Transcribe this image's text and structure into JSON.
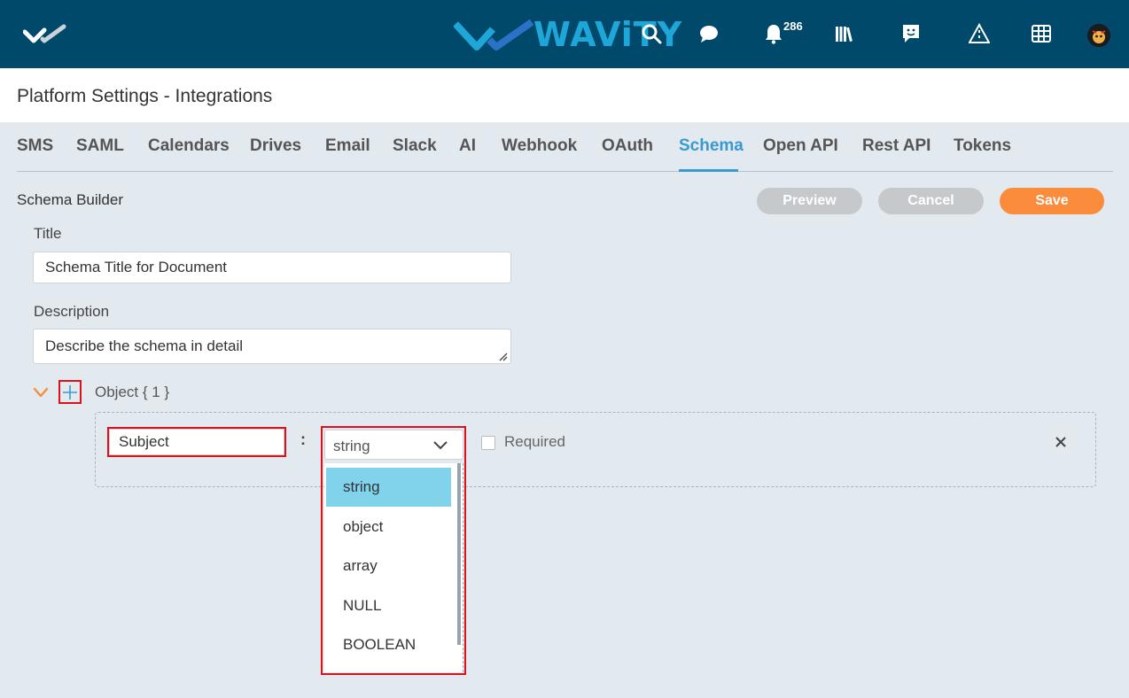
{
  "header": {
    "brand_name": "WAViTY",
    "notification_count": "286",
    "icons": [
      "double-check-logo-icon",
      "search-icon",
      "chat-icon",
      "bell-icon",
      "library-icon",
      "feedback-icon",
      "road-icon",
      "grid-icon",
      "avatar"
    ]
  },
  "page": {
    "title": "Platform Settings - Integrations"
  },
  "tabs": [
    {
      "label": "SMS"
    },
    {
      "label": "SAML"
    },
    {
      "label": "Calendars"
    },
    {
      "label": "Drives"
    },
    {
      "label": "Email"
    },
    {
      "label": "Slack"
    },
    {
      "label": "AI"
    },
    {
      "label": "Webhook"
    },
    {
      "label": "OAuth"
    },
    {
      "label": "Schema",
      "active": true
    },
    {
      "label": "Open API"
    },
    {
      "label": "Rest API"
    },
    {
      "label": "Tokens"
    }
  ],
  "schema_builder": {
    "heading": "Schema Builder",
    "preview_label": "Preview",
    "cancel_label": "Cancel",
    "save_label": "Save",
    "title_label": "Title",
    "title_value": "Schema Title for Document",
    "description_label": "Description",
    "description_value": "Describe the schema in detail",
    "object_label": "Object { 1 }",
    "property": {
      "name_value": "Subject",
      "colon": ":",
      "type_value": "string",
      "type_options": [
        "string",
        "object",
        "array",
        "NULL",
        "BOOLEAN"
      ],
      "selected_option": "string",
      "required_label": "Required",
      "remove_glyph": "×"
    }
  },
  "colors": {
    "header_bg": "#00496b",
    "accent": "#3a9ad0",
    "save": "#fb8c3c",
    "highlight": "#e0101a",
    "selected_option": "#80d3ea"
  }
}
